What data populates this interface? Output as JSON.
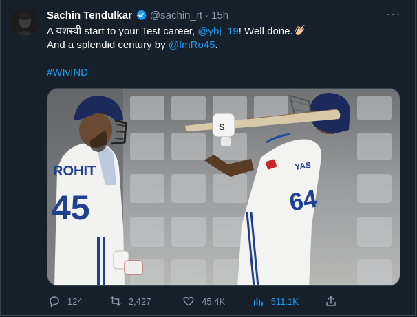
{
  "tweet": {
    "author_name": "Sachin Tendulkar",
    "handle": "@sachin_rt",
    "separator": "·",
    "time": "15h",
    "more_label": "···",
    "line1_a": "A यशस्वी start to your Test career, ",
    "mention1": "@ybj_19",
    "line1_b": "! Well done.",
    "line2_a": "And a splendid century by ",
    "mention2": "@ImRo45",
    "line2_b": ".",
    "hashtag": "#WIvIND",
    "media": {
      "left_jersey_name": "ROHIT",
      "left_jersey_number": "45",
      "right_jersey_number": "64",
      "right_jersey_name": "YAS"
    }
  },
  "actions": {
    "replies": "124",
    "retweets": "2,427",
    "likes": "45.4K",
    "views": "511.1K"
  },
  "colors": {
    "background": "#15202b",
    "accent": "#1d9bf0",
    "muted": "#8b98a5"
  },
  "icons": [
    "verified-badge-icon",
    "more-options-icon",
    "clapping-hands-icon",
    "reply-icon",
    "retweet-icon",
    "like-icon",
    "views-icon",
    "share-icon"
  ]
}
